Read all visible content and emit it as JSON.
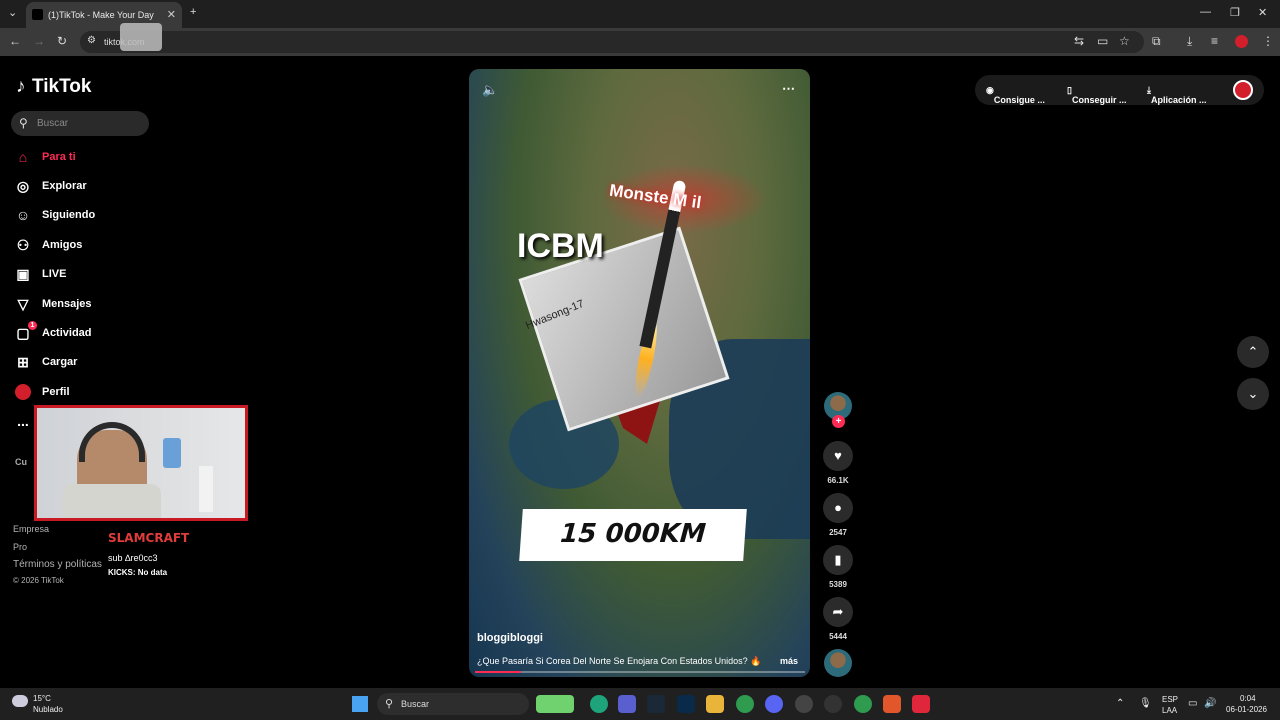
{
  "browser": {
    "tab_title": "(1)TikTok - Make Your Day",
    "url": "tiktok.com",
    "new_tab_symbol": "+"
  },
  "tiktok": {
    "logo": "TikTok",
    "search_placeholder": "Buscar",
    "nav": [
      {
        "label": "Para ti",
        "icon": "home-icon"
      },
      {
        "label": "Explorar",
        "icon": "compass-icon"
      },
      {
        "label": "Siguiendo",
        "icon": "following-icon"
      },
      {
        "label": "Amigos",
        "icon": "friends-icon"
      },
      {
        "label": "LIVE",
        "icon": "live-icon"
      },
      {
        "label": "Mensajes",
        "icon": "messages-icon"
      },
      {
        "label": "Actividad",
        "icon": "activity-icon",
        "badge": "1"
      },
      {
        "label": "Cargar",
        "icon": "upload-icon"
      },
      {
        "label": "Perfil",
        "icon": "profile-icon"
      },
      {
        "label": "..."
      }
    ],
    "footer": {
      "empresa": "Empresa",
      "terms": "Términos y políticas",
      "copyright": "© 2026 TikTok",
      "partial_cu": "Cu",
      "partial_pro": "Pro"
    },
    "topbar": {
      "item1": "Consigue ...",
      "item2": "Conseguir ...",
      "item3": "Aplicación ..."
    },
    "video": {
      "text_monster": "Monste M il",
      "text_icbm": "ICBM",
      "text_hwasong": "Hwasong-17",
      "text_distance": "15 000KM",
      "author": "bloggibloggi",
      "description": "¿Que Pasaría Si Corea Del Norte Se Enojara Con Estados Unidos? 🔥",
      "more": "más",
      "progress": 0.14
    },
    "actions": {
      "follow_symbol": "+",
      "likes": "66.1K",
      "comments": "2547",
      "saves": "5389",
      "shares": "5444"
    }
  },
  "overlay": {
    "streamer": "SLAMCRAFT",
    "sub_line": "sub ∆re0cc3",
    "kicks": "KICKS: No data"
  },
  "taskbar": {
    "weather_temp": "15°C",
    "weather_desc": "Nublado",
    "search_label": "Buscar",
    "lang": "ESP",
    "lang2": "LAA",
    "time": "0:04",
    "date": "06-01-2026"
  },
  "colors": {
    "accent": "#fe2c55",
    "overlay_border": "#c81a25"
  }
}
